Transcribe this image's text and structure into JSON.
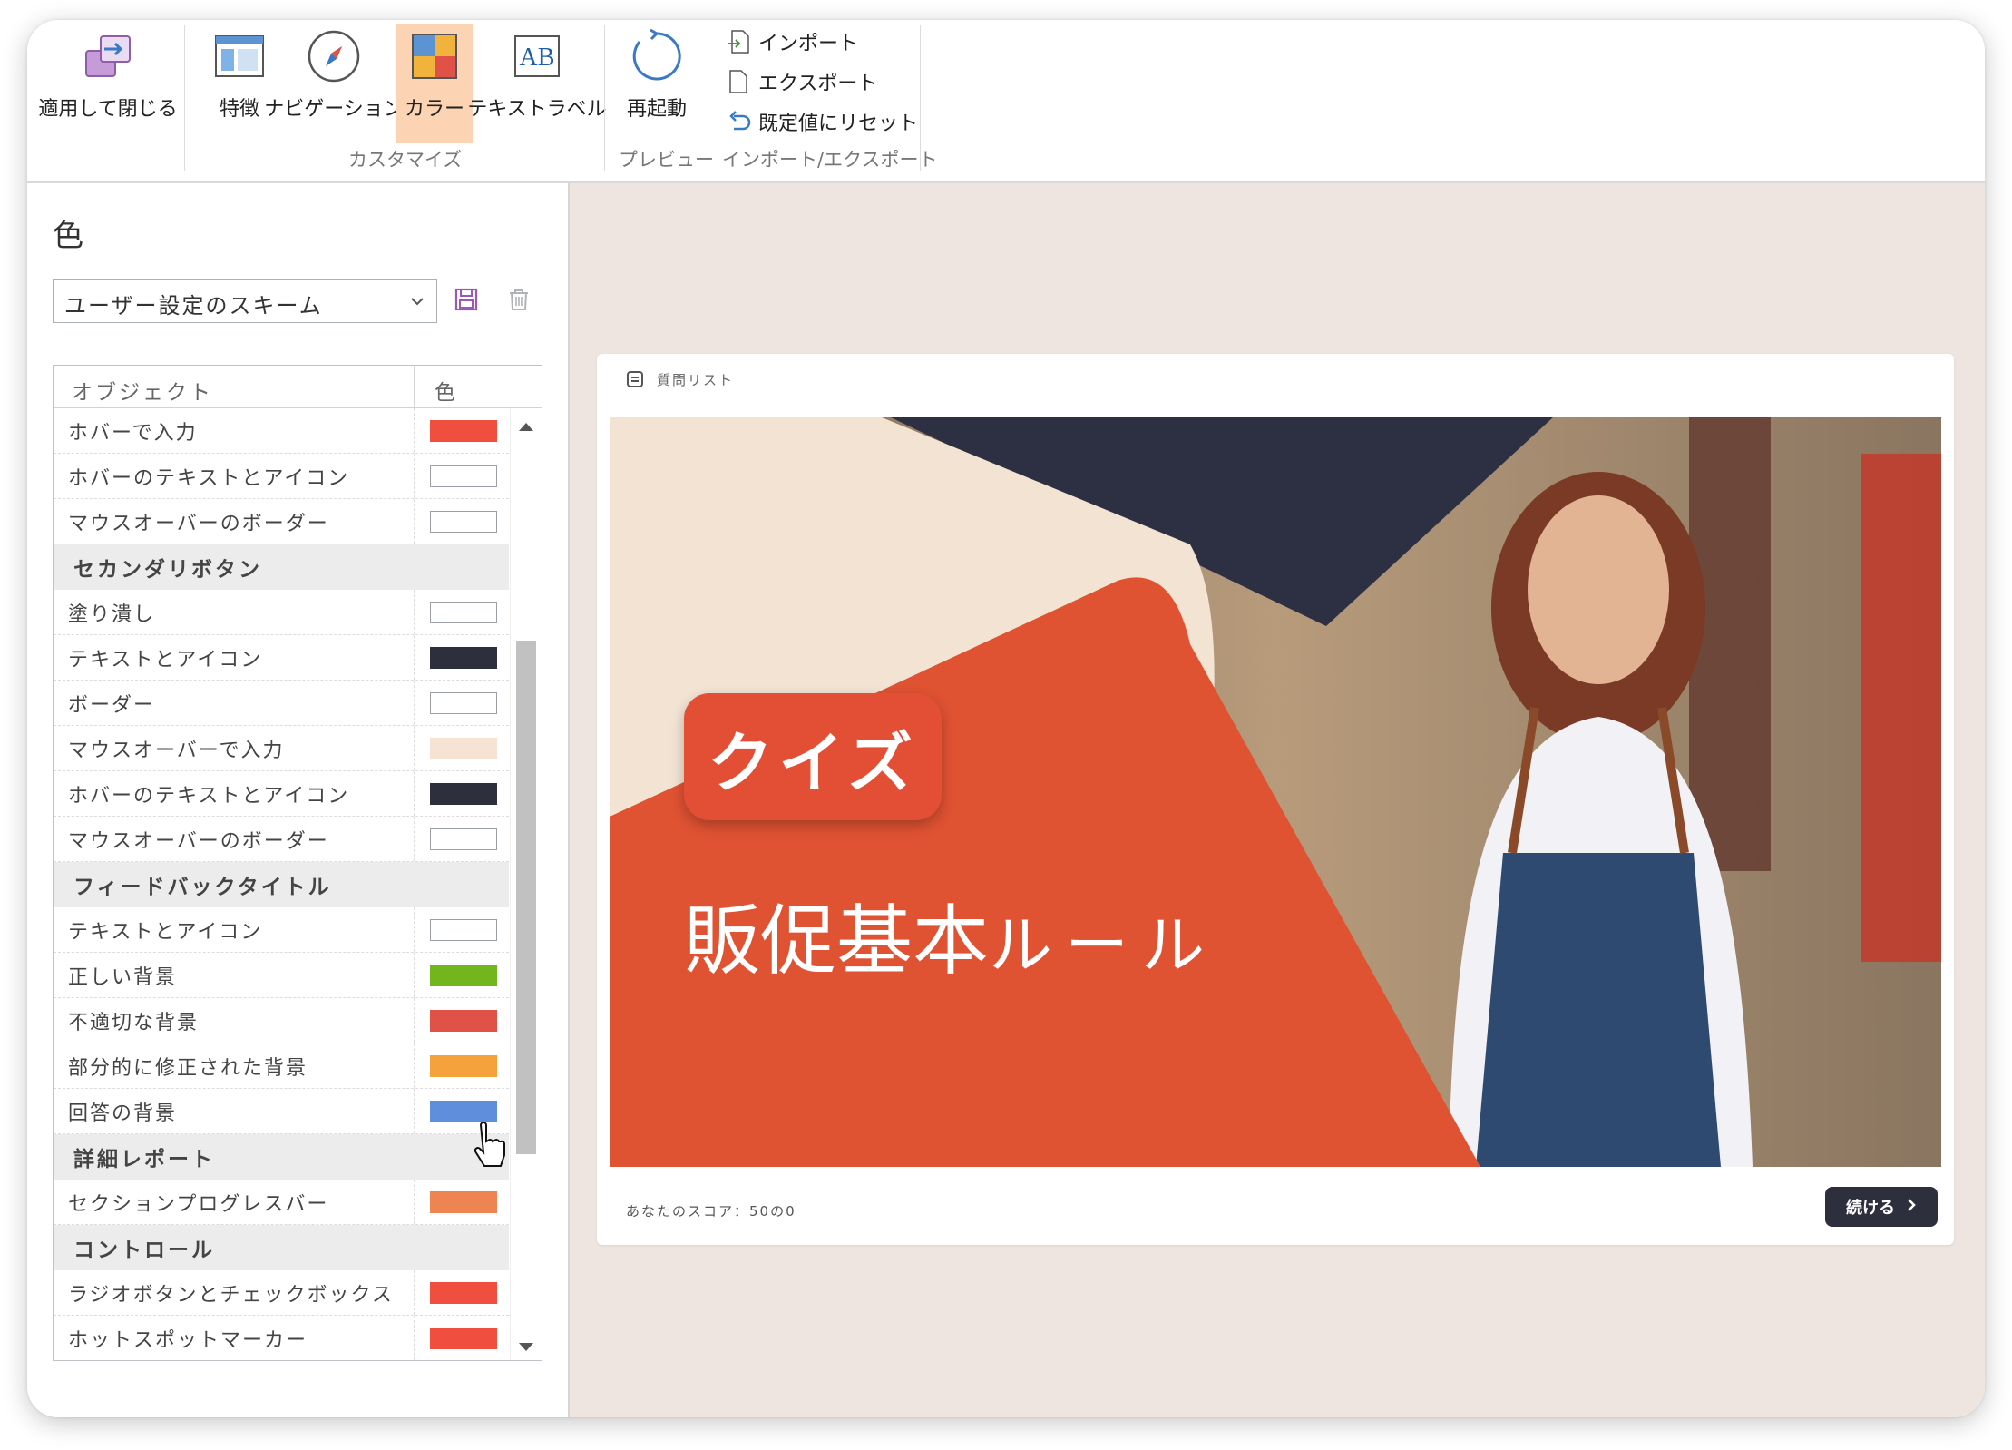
{
  "ribbon": {
    "apply_close": "適用して閉じる",
    "features": "特徴",
    "navigation": "ナビゲーション",
    "colors": "カラー",
    "text_labels": "テキストラベル",
    "restart": "再起動",
    "import": "インポート",
    "export": "エクスポート",
    "reset_defaults": "既定値にリセット",
    "group_customize": "カスタマイズ",
    "group_preview": "プレビュー",
    "group_import_export": "インポート/エクスポート"
  },
  "panel": {
    "title": "色",
    "scheme_selected": "ユーザー設定のスキーム",
    "col_object": "オブジェクト",
    "col_color": "色"
  },
  "rows": [
    {
      "label": "ホバーで入力",
      "color": "#f04e3e"
    },
    {
      "label": "ホバーのテキストとアイコン",
      "color": "#ffffff"
    },
    {
      "label": "マウスオーバーのボーダー",
      "color": "#ffffff"
    },
    {
      "group": "セカンダリボタン"
    },
    {
      "label": "塗り潰し",
      "color": "#ffffff"
    },
    {
      "label": "テキストとアイコン",
      "color": "#2d2f3d"
    },
    {
      "label": "ボーダー",
      "color": "#ffffff"
    },
    {
      "label": "マウスオーバーで入力",
      "color": "#f6e3d4"
    },
    {
      "label": "ホバーのテキストとアイコン",
      "color": "#2d2f3d"
    },
    {
      "label": "マウスオーバーのボーダー",
      "color": "#ffffff"
    },
    {
      "group": "フィードバックタイトル"
    },
    {
      "label": "テキストとアイコン",
      "color": "#ffffff"
    },
    {
      "label": "正しい背景",
      "color": "#72b51c"
    },
    {
      "label": "不適切な背景",
      "color": "#e05248"
    },
    {
      "label": "部分的に修正された背景",
      "color": "#f5a23c"
    },
    {
      "label": "回答の背景",
      "color": "#5f8fdc"
    },
    {
      "group": "詳細レポート"
    },
    {
      "label": "セクションプログレスバー",
      "color": "#ee8451"
    },
    {
      "group": "コントロール"
    },
    {
      "label": "ラジオボタンとチェックボックス",
      "color": "#f04e3e"
    },
    {
      "label": "ホットスポットマーカー",
      "color": "#f04e3e"
    }
  ],
  "preview": {
    "top_label": "質問リスト",
    "badge": "クイズ",
    "title_bold": "販促基本",
    "title_light": "ルール",
    "score": "あなたのスコア：50の0",
    "continue": "続ける"
  },
  "colors": {
    "accent": "#e24f35",
    "ribbon_active": "#fcd3b3",
    "preview_bg": "#efe5e0",
    "dark_button": "#2d2f3d"
  }
}
